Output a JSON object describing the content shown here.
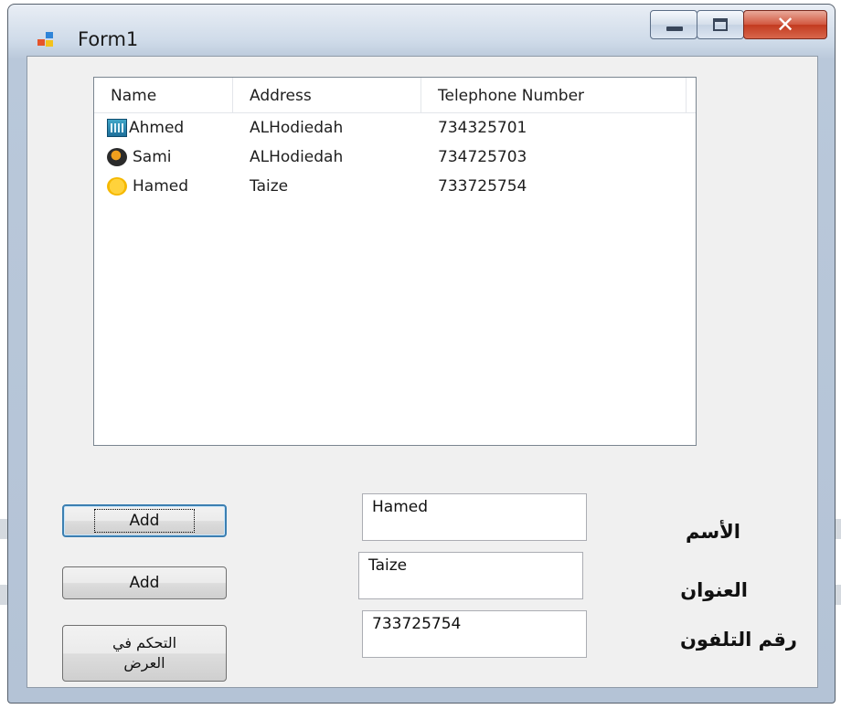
{
  "window": {
    "title": "Form1",
    "controls": {
      "minimize": "minimize",
      "maximize": "maximize",
      "close": "close"
    }
  },
  "listview": {
    "columns": [
      "Name",
      "Address",
      "Telephone Number"
    ],
    "rows": [
      {
        "icon": "calculator-icon",
        "name": "Ahmed",
        "address": "ALHodiedah",
        "phone": "734325701"
      },
      {
        "icon": "orb-icon",
        "name": "Sami",
        "address": "ALHodiedah",
        "phone": "734725703"
      },
      {
        "icon": "smiley-icon",
        "name": "Hamed",
        "address": "Taize",
        "phone": "733725754"
      }
    ]
  },
  "buttons": {
    "add_1": "Add",
    "add_2": "Add",
    "view_control": "التحكم في العرض"
  },
  "fields": {
    "name_value": "Hamed",
    "address_value": "Taize",
    "phone_value": "733725754"
  },
  "labels": {
    "name": "الأسم",
    "address": "العنوان",
    "phone": "رقم التلفون"
  },
  "colors": {
    "close_button": "#c23a1f",
    "window_frame": "#b9c8da",
    "client_bg": "#f0f0f0",
    "focus_border": "#3c7fb1"
  }
}
